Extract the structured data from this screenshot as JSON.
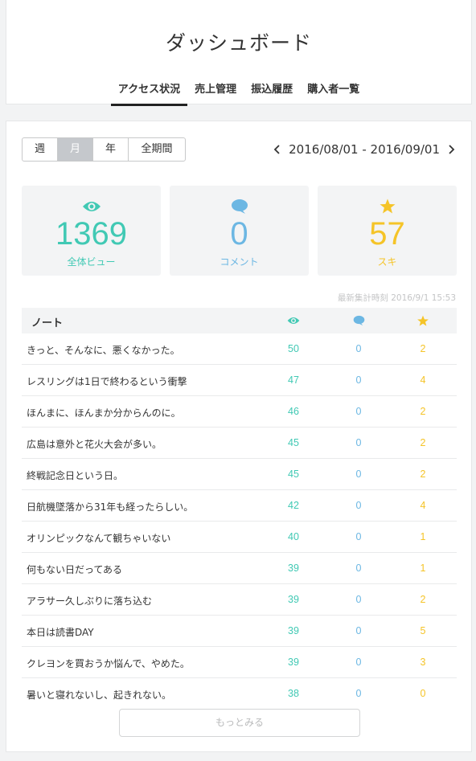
{
  "header": {
    "title": "ダッシュボード",
    "tabs": [
      {
        "label": "アクセス状況",
        "active": true
      },
      {
        "label": "売上管理",
        "active": false
      },
      {
        "label": "振込履歴",
        "active": false
      },
      {
        "label": "購入者一覧",
        "active": false
      }
    ]
  },
  "period": {
    "options": [
      "週",
      "月",
      "年",
      "全期間"
    ],
    "selected": "月"
  },
  "date_range": "2016/08/01 - 2016/09/01",
  "stats": {
    "views": {
      "value": "1369",
      "label": "全体ビュー",
      "icon": "eye-icon",
      "color": "#41c9b4"
    },
    "comments": {
      "value": "0",
      "label": "コメント",
      "icon": "speech-bubble-icon",
      "color": "#6cb7e3"
    },
    "likes": {
      "value": "57",
      "label": "スキ",
      "icon": "star-icon",
      "color": "#f5c428"
    }
  },
  "timestamp": "最新集計時刻 2016/9/1 15:53",
  "table": {
    "note_header": "ノート",
    "rows": [
      {
        "title": "きっと、そんなに、悪くなかった。",
        "views": "50",
        "comments": "0",
        "likes": "2"
      },
      {
        "title": "レスリングは1日で終わるという衝撃",
        "views": "47",
        "comments": "0",
        "likes": "4"
      },
      {
        "title": "ほんまに、ほんまか分からんのに。",
        "views": "46",
        "comments": "0",
        "likes": "2"
      },
      {
        "title": "広島は意外と花火大会が多い。",
        "views": "45",
        "comments": "0",
        "likes": "2"
      },
      {
        "title": "終戦記念日という日。",
        "views": "45",
        "comments": "0",
        "likes": "2"
      },
      {
        "title": "日航機墜落から31年も経ったらしい。",
        "views": "42",
        "comments": "0",
        "likes": "4"
      },
      {
        "title": "オリンピックなんて観ちゃいない",
        "views": "40",
        "comments": "0",
        "likes": "1"
      },
      {
        "title": "何もない日だってある",
        "views": "39",
        "comments": "0",
        "likes": "1"
      },
      {
        "title": "アラサー久しぶりに落ち込む",
        "views": "39",
        "comments": "0",
        "likes": "2"
      },
      {
        "title": "本日は読書DAY",
        "views": "39",
        "comments": "0",
        "likes": "5"
      },
      {
        "title": "クレヨンを買おうか悩んで、やめた。",
        "views": "39",
        "comments": "0",
        "likes": "3"
      },
      {
        "title": "暑いと寝れないし、起きれない。",
        "views": "38",
        "comments": "0",
        "likes": "0"
      }
    ]
  },
  "more_button": "もっとみる",
  "colors": {
    "accent_green": "#41c9b4",
    "accent_blue": "#6cb7e3",
    "accent_yellow": "#f5c428"
  }
}
